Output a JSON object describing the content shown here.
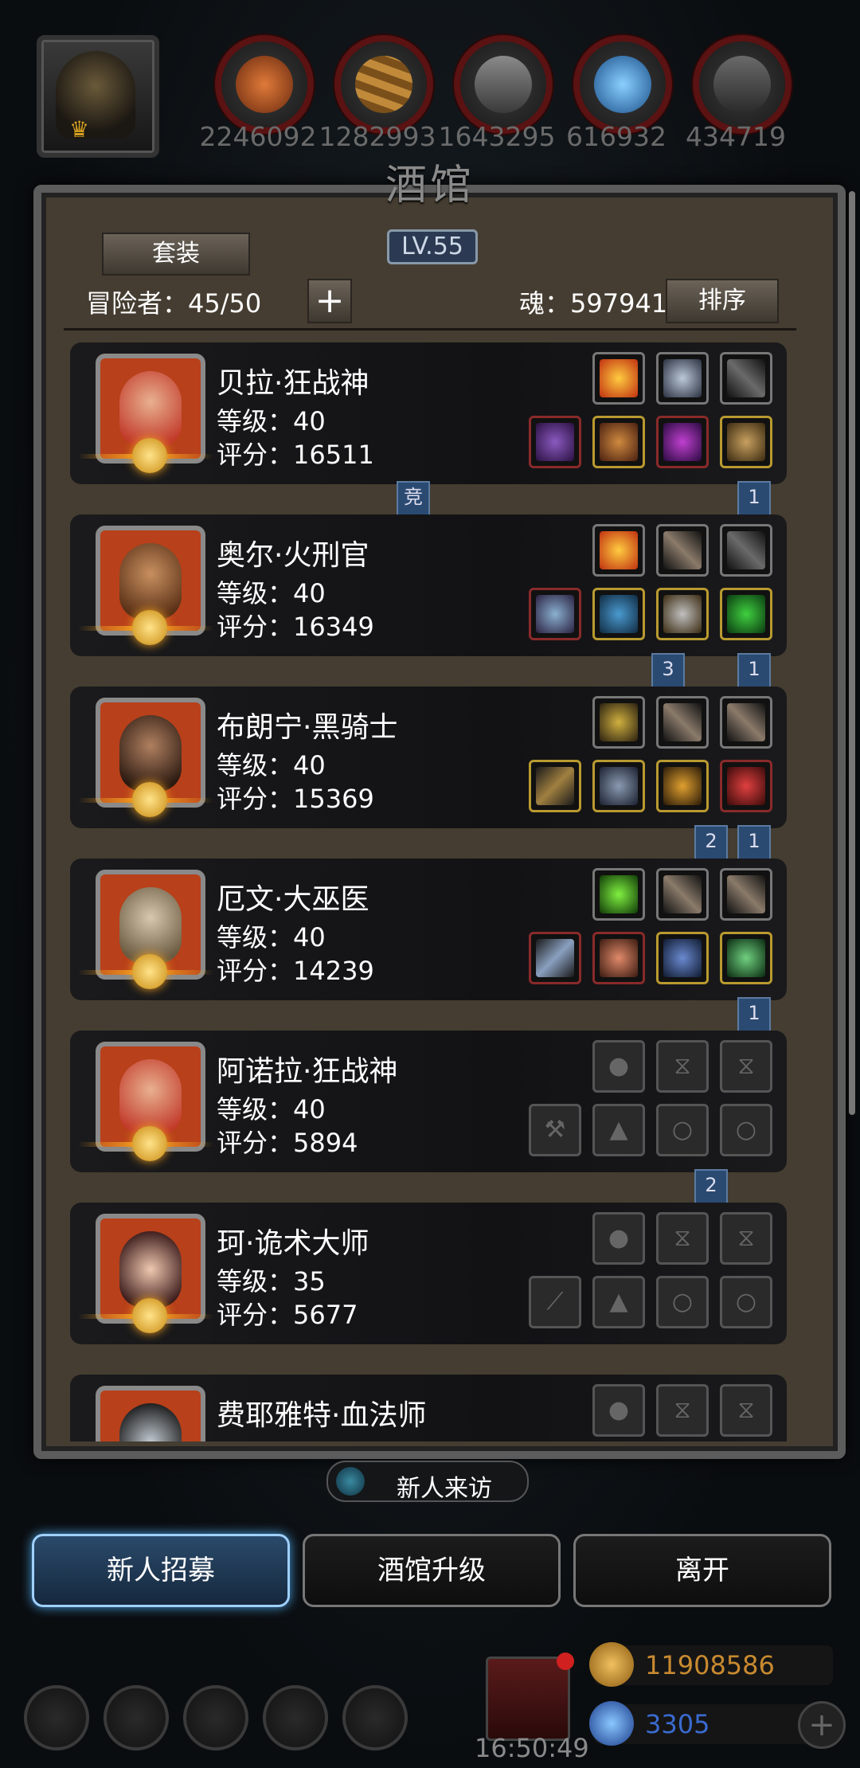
{
  "top_bar": {
    "resources": [
      {
        "icon": "meat-resource-icon",
        "value": "2246092",
        "color": "#b5531c"
      },
      {
        "icon": "wood-resource-icon",
        "value": "1282993",
        "color": "#a0702a"
      },
      {
        "icon": "stone-resource-icon",
        "value": "1643295",
        "color": "#6a6a6a"
      },
      {
        "icon": "crystal-resource-icon",
        "value": "616932",
        "color": "#2f7fbf"
      },
      {
        "icon": "iron-resource-icon",
        "value": "434719",
        "color": "#5a5a5a"
      }
    ]
  },
  "panel": {
    "title": "酒馆",
    "level": "LV.55",
    "suit_button": "套装",
    "adventurer_label": "冒险者：45/50",
    "add_icon": "plus-icon",
    "soul_label": "魂：597941",
    "sort_button": "排序"
  },
  "heroes": [
    {
      "name": "贝拉·狂战神",
      "level": "等级：40",
      "score": "评分：16511",
      "face": "#c23a2a"
    },
    {
      "name": "奥尔·火刑官",
      "level": "等级：40",
      "score": "评分：16349",
      "face": "#7a4a2a"
    },
    {
      "name": "布朗宁·黑骑士",
      "level": "等级：40",
      "score": "评分：15369",
      "face": "#4a3424"
    },
    {
      "name": "厄文·大巫医",
      "level": "等级：40",
      "score": "评分：14239",
      "face": "#9a8a70"
    },
    {
      "name": "阿诺拉·狂战神",
      "level": "等级：40",
      "score": "评分：5894",
      "face": "#c23a2a"
    },
    {
      "name": "珂·诡术大师",
      "level": "等级：35",
      "score": "评分：5677",
      "face": "#5a3a3a"
    },
    {
      "name": "费耶雅特·血法师",
      "level": "",
      "score": "",
      "face": "#2a2a2a"
    }
  ],
  "badges": [
    {
      "label": "竞"
    },
    {
      "label": "1"
    },
    {
      "label": "3"
    },
    {
      "label": "1"
    },
    {
      "label": "2"
    },
    {
      "label": "1"
    },
    {
      "label": "1"
    },
    {
      "label": "2"
    }
  ],
  "bottom": {
    "visitor_button": "新人来访",
    "recruit_button": "新人招募",
    "upgrade_button": "酒馆升级",
    "leave_button": "离开",
    "time": "16:50:49",
    "gold": "11908586",
    "gems": "3305",
    "gold_color": "#c88a30",
    "gem_color": "#3a6ad0"
  }
}
